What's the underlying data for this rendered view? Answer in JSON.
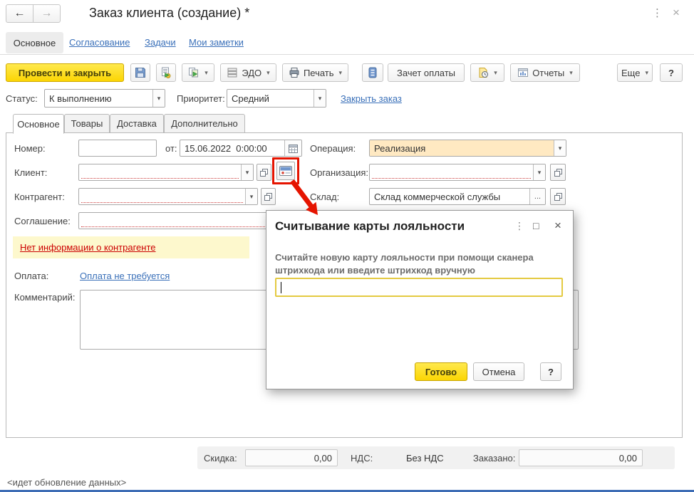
{
  "header": {
    "title": "Заказ клиента (создание) *"
  },
  "glyphs": {
    "back": "←",
    "forward": "→",
    "kebab": "⋮",
    "close": "×",
    "maximize": "□",
    "dropdown": "▾",
    "ellipsis": "..."
  },
  "nav": {
    "items": [
      {
        "label": "Основное"
      },
      {
        "label": "Согласование"
      },
      {
        "label": "Задачи"
      },
      {
        "label": "Мои заметки"
      }
    ]
  },
  "toolbar": {
    "post_close_label": "Провести и закрыть",
    "edo_label": "ЭДО",
    "print_label": "Печать",
    "payment_offset_label": "Зачет оплаты",
    "reports_label": "Отчеты",
    "more_label": "Еще",
    "help_label": "?"
  },
  "status_row": {
    "status_label": "Статус:",
    "status_value": "К выполнению",
    "priority_label": "Приоритет:",
    "priority_value": "Средний",
    "close_order_link": "Закрыть заказ"
  },
  "tabs": {
    "items": [
      {
        "label": "Основное"
      },
      {
        "label": "Товары"
      },
      {
        "label": "Доставка"
      },
      {
        "label": "Дополнительно"
      }
    ]
  },
  "form": {
    "number_label": "Номер:",
    "number_value": "",
    "date_prefix": "от:",
    "date_value": "15.06.2022  0:00:00",
    "client_label": "Клиент:",
    "client_value": "",
    "counterparty_label": "Контрагент:",
    "counterparty_value": "",
    "agreement_label": "Соглашение:",
    "agreement_value": "",
    "warning_link": "Нет информации о контрагенте",
    "payment_label": "Оплата:",
    "payment_link": "Оплата не требуется",
    "comment_label": "Комментарий:",
    "comment_value": "",
    "operation_label": "Операция:",
    "operation_value": "Реализация",
    "organization_label": "Организация:",
    "organization_value": "",
    "warehouse_label": "Склад:",
    "warehouse_value": "Склад коммерческой службы"
  },
  "modal": {
    "title": "Считывание карты лояльности",
    "instruction": "Считайте новую карту лояльности при помощи сканера штрихкода или введите штрихкод вручную",
    "barcode_value": "",
    "done_label": "Готово",
    "cancel_label": "Отмена",
    "help_label": "?"
  },
  "totals": {
    "discount_label": "Скидка:",
    "discount_value": "0,00",
    "vat_label": "НДС:",
    "vat_value": "Без НДС",
    "ordered_label": "Заказано:",
    "ordered_value": "0,00"
  },
  "statusbar": {
    "text": "<идет обновление данных>"
  },
  "colors": {
    "accent_yellow": "#fbd503",
    "operation_bg": "#ffe9c2",
    "link_blue": "#3a70b9",
    "warning_red": "#cc0000",
    "highlight_red": "#e51400"
  }
}
